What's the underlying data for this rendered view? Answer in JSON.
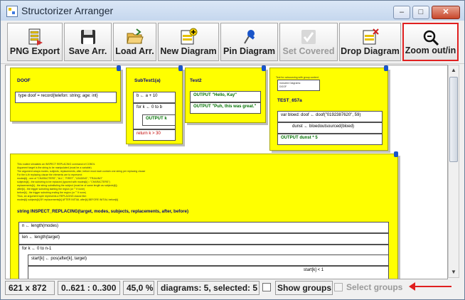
{
  "window": {
    "title": "Structorizer Arranger"
  },
  "title_buttons": {
    "minimize": "–",
    "maximize": "□",
    "close": "✕"
  },
  "toolbar": {
    "png_export": "PNG Export",
    "save_arr": "Save Arr.",
    "load_arr": "Load Arr.",
    "new_diagram": "New Diagram",
    "pin_diagram": "Pin Diagram",
    "set_covered": "Set Covered",
    "drop_diagram": "Drop Diagram",
    "zoom": "Zoom out/in"
  },
  "diagrams": {
    "doof": {
      "title": "DOOF",
      "line": "type doof = record{telefon: string; age: int}"
    },
    "subtest1": {
      "title": "SubTest1(a)",
      "l1": "b ← a + 10",
      "l2": "for k ← 0 to b",
      "l3": "OUTPUT k",
      "l4": "return k > 30"
    },
    "test2": {
      "title": "Test2",
      "l1": "OUTPUT \"Hello, Kay\"",
      "l2": "OUTPUT \"Puh, this was great.\""
    },
    "test657": {
      "comment": "Test for outsourcing with group context",
      "included_1": "Included Diagrams:",
      "included_2": "DOOF",
      "title": "TEST_657a",
      "l1": "var bloed: doof ← doof(\"0192387620\", 59)",
      "l2": "dunst ← bloedoutsourced(bloed)",
      "l3": "OUTPUT dunst * 5"
    },
    "inspect": {
      "c1": "This routine simulates an INSPECT REPLACING command of COBOL",
      "c2": "Argument target is the string to be manipulated (must be a variable)",
      "c3": "The argument arrays modes, subjects, replacements, after, before must each contain one string per replacing clause",
      "c4": "For the k-th replacing clause the elements are to represent:",
      "c5": "modes[k] - one of \"CHARACTERS\", \"ALL\", \"FIRST\", \"LEADING\", \"TRAILING\"",
      "c6": "subjects[k] - the substring to be replaced (ignored with modes[k] = \"CHARACTERS\")",
      "c7": "replacements[k] - the string substituting the subject (must be of same length as subjects[k])",
      "c8": "after[k] - the trigger substring starting the region (or \"\" if none)",
      "c9": "before[k] - the trigger substring ending the region (or \"\" if none)",
      "c10": "Thus, an argument tuple represents a REPLACING clause like:",
      "c11": "modes[k] subjects[k] BY replacements[k] AFTER INITIAL after[k] BEFORE INITIAL before[k]",
      "header": "string INSPECT_REPLACING(target, modes, subjects, replacements, after, before)",
      "l1": "n ← length(modes)",
      "l2": "len ← length(target)",
      "l3": "for k ← 0 to n-1",
      "l4": "start[k] ← pos(after[k], target)",
      "l5": "start[k] < 1"
    }
  },
  "status": {
    "size": "621 x 872",
    "range": "0..621 : 0..300",
    "zoom": "45,0 %",
    "diagrams": "diagrams: 5, selected: 5",
    "show_groups": "Show groups",
    "select_groups": "Select groups"
  },
  "colors": {
    "diagram_bg": "#ffff00",
    "highlight": "#e02020"
  }
}
